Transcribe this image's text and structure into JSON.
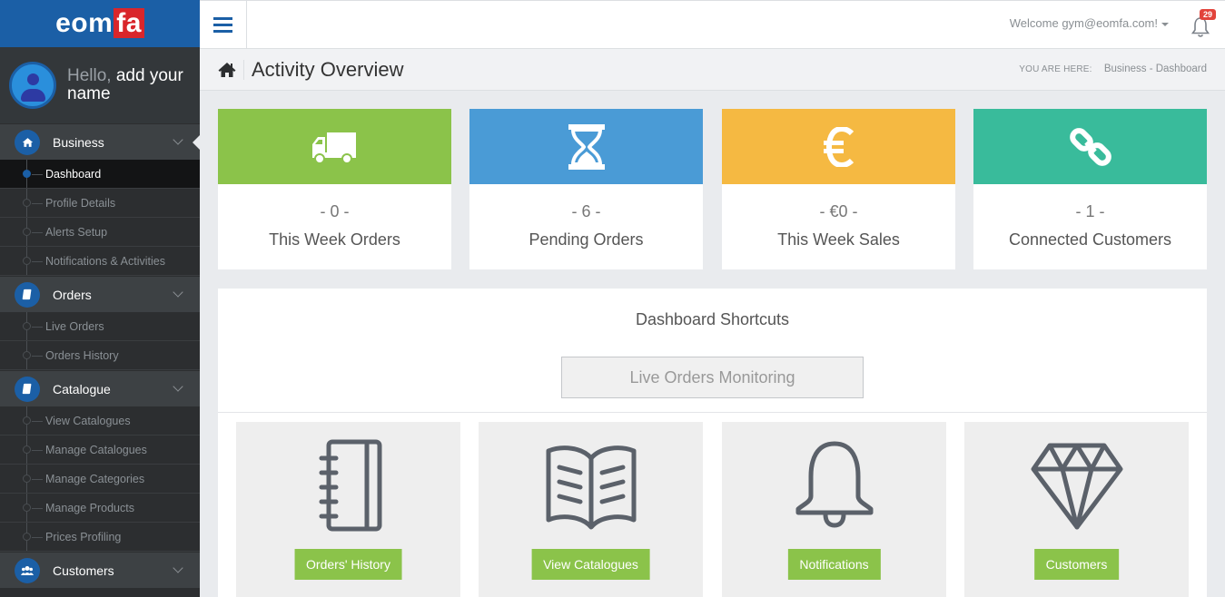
{
  "brand": {
    "logo_left": "eom",
    "logo_right": "fa",
    "primary": "#1b5fa6",
    "logo_accent": "#d9262b"
  },
  "profile": {
    "hello": "Hello,",
    "name_line1": "add your",
    "name_line2": "name"
  },
  "sidebar": {
    "sections": [
      {
        "label": "Business",
        "icon": "home-icon",
        "items": [
          "Dashboard",
          "Profile Details",
          "Alerts Setup",
          "Notifications & Activities"
        ]
      },
      {
        "label": "Orders",
        "icon": "book-icon",
        "items": [
          "Live Orders",
          "Orders History"
        ]
      },
      {
        "label": "Catalogue",
        "icon": "book-icon",
        "items": [
          "View Catalogues",
          "Manage Catalogues",
          "Manage Categories",
          "Manage Products",
          "Prices Profiling"
        ]
      },
      {
        "label": "Customers",
        "icon": "users-icon",
        "items": []
      }
    ],
    "active_item": "Dashboard"
  },
  "topbar": {
    "welcome": "Welcome gym@eomfa.com!",
    "notification_count": "29"
  },
  "header": {
    "title": "Activity Overview",
    "breadcrumb_prefix": "YOU ARE HERE:",
    "breadcrumb_path": "Business - Dashboard"
  },
  "stats": [
    {
      "value": "- 0 -",
      "label": "This Week Orders",
      "color": "#8bc34a",
      "icon": "truck-icon"
    },
    {
      "value": "- 6 -",
      "label": "Pending Orders",
      "color": "#4a9bd6",
      "icon": "hourglass-icon"
    },
    {
      "value": "- €0 -",
      "label": "This Week Sales",
      "color": "#f5b942",
      "icon": "euro-icon"
    },
    {
      "value": "- 1 -",
      "label": "Connected Customers",
      "color": "#39bb9b",
      "icon": "link-icon"
    }
  ],
  "shortcuts": {
    "title": "Dashboard Shortcuts",
    "live_button": "Live Orders Monitoring",
    "cards": [
      {
        "label": "Orders' History",
        "icon": "notebook-icon"
      },
      {
        "label": "View Catalogues",
        "icon": "open-book-icon"
      },
      {
        "label": "Notifications",
        "icon": "bell-icon"
      },
      {
        "label": "Customers",
        "icon": "diamond-icon"
      }
    ]
  }
}
